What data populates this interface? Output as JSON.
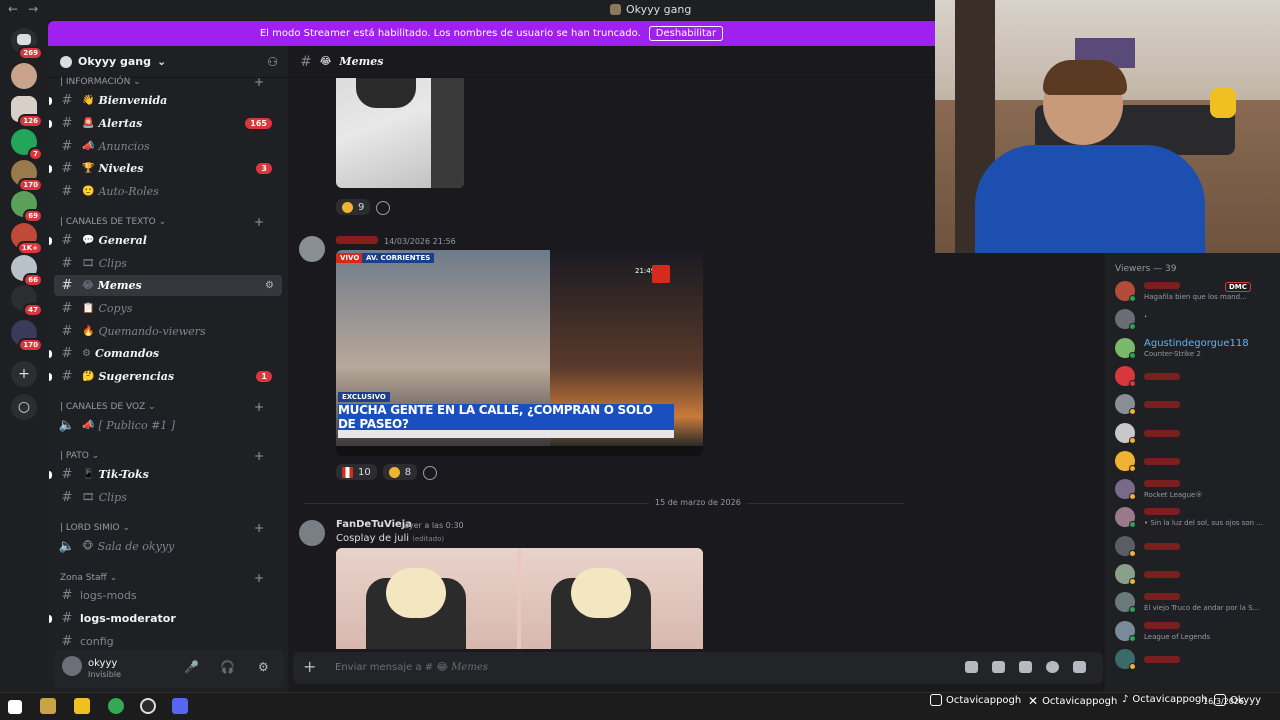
{
  "window": {
    "title": "Okyyy gang"
  },
  "banner": {
    "text": "El modo Streamer está habilitado. Los nombres de usuario se han truncado.",
    "button": "Deshabilitar"
  },
  "rail_badges": [
    "269",
    "126",
    "7",
    "170",
    "69",
    "1K+",
    "66",
    "47",
    "170"
  ],
  "server": {
    "name": "Okyyy gang"
  },
  "categories": [
    "| INFORMACIÓN",
    "| CANALES DE TEXTO",
    "| CANALES DE VOZ",
    "| PATO",
    "| LORD SIMIO",
    "Zona Staff"
  ],
  "channels": [
    {
      "name": "Bienvenida",
      "badge": ""
    },
    {
      "name": "Alertas",
      "badge": "165"
    },
    {
      "name": "Anuncios",
      "badge": ""
    },
    {
      "name": "Niveles",
      "badge": "3"
    },
    {
      "name": "Auto-Roles",
      "badge": ""
    },
    {
      "name": "General",
      "badge": ""
    },
    {
      "name": "Clips",
      "badge": ""
    },
    {
      "name": "Memes",
      "badge": ""
    },
    {
      "name": "Copys",
      "badge": ""
    },
    {
      "name": "Quemando-viewers",
      "badge": ""
    },
    {
      "name": "Comandos",
      "badge": ""
    },
    {
      "name": "Sugerencias",
      "badge": "1"
    },
    {
      "name": "[ Publico #1 ]",
      "badge": ""
    },
    {
      "name": "Tik-Toks",
      "badge": ""
    },
    {
      "name": "Clips",
      "badge": ""
    },
    {
      "name": "Sala de okyyy",
      "badge": ""
    },
    {
      "name": "logs-mods",
      "badge": ""
    },
    {
      "name": "logs-moderator",
      "badge": ""
    },
    {
      "name": "config",
      "badge": ""
    }
  ],
  "user": {
    "name": "okyyy",
    "status": "Invisible"
  },
  "chat": {
    "channel": "Memes",
    "composer_prefix": "Enviar mensaje a #",
    "msg1": {
      "reaction_count": "9"
    },
    "msg2": {
      "timestamp": "14/03/2026 21:56",
      "tv_banner": "MUCHA GENTE EN LA CALLE, ¿COMPRAN O SOLO DE PASEO?",
      "tv_tag": "EXCLUSIVO",
      "tv_live": "VIVO",
      "tv_place": "AV. CORRIENTES",
      "tv_time": "21:49",
      "reaction1": "10",
      "reaction2": "8"
    },
    "date_divider": "15 de marzo de 2026",
    "msg3": {
      "author": "FanDeTuVieja",
      "timestamp": "ayer a las 0:30",
      "text": "Cosplay de juli",
      "edited": "(editado)"
    }
  },
  "members": {
    "header": "Viewers — 39",
    "list": [
      {
        "name": "",
        "activity": "Hagañla bien que los mand...",
        "tag": "DMC",
        "color": "#da373c"
      },
      {
        "name": ".",
        "activity": "",
        "tag": "",
        "color": "#dbdee1"
      },
      {
        "name": "Agustindegorgue118",
        "activity": "Counter-Strike 2",
        "tag": "",
        "color": "#5fb4f5"
      },
      {
        "name": "",
        "activity": "",
        "tag": "",
        "color": "#da373c"
      },
      {
        "name": "",
        "activity": "",
        "tag": "",
        "color": "#da373c"
      },
      {
        "name": "",
        "activity": "",
        "tag": "",
        "color": "#da373c"
      },
      {
        "name": "",
        "activity": "",
        "tag": "",
        "color": "#da373c"
      },
      {
        "name": "",
        "activity": "Rocket League®",
        "tag": "",
        "color": "#da373c"
      },
      {
        "name": "",
        "activity": "• Sin la luz del sol, sus ojos son ...",
        "tag": "",
        "color": "#da373c"
      },
      {
        "name": "",
        "activity": "",
        "tag": "",
        "color": "#da373c"
      },
      {
        "name": "",
        "activity": "",
        "tag": "",
        "color": "#da373c"
      },
      {
        "name": "",
        "activity": "El viejo Truco de andar por la S...",
        "tag": "",
        "color": "#da373c"
      },
      {
        "name": "",
        "activity": "League of Legends",
        "tag": "",
        "color": "#da373c"
      },
      {
        "name": "",
        "activity": "",
        "tag": "",
        "color": "#da373c"
      }
    ]
  },
  "overlay": {
    "handle1": "Octavicappogh",
    "handle2": "Octavicappogh",
    "handle3": "Octavicappogh",
    "handle4": "Okyyy"
  },
  "clock": {
    "date": "16/3/2026"
  }
}
